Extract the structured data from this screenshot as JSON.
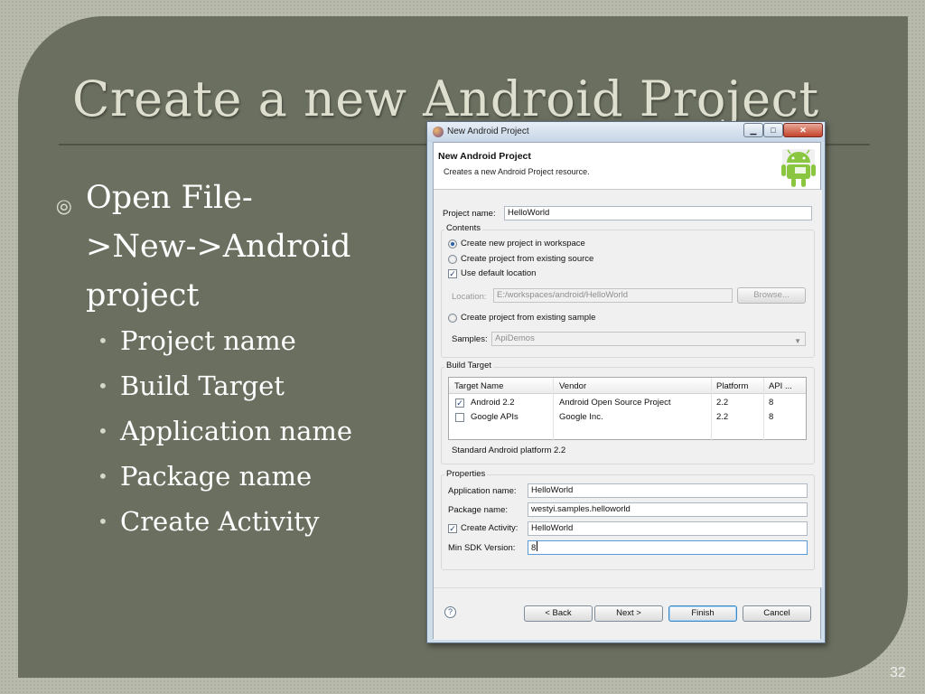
{
  "slide": {
    "title": "Create a new Android Project",
    "main_bullet_marker": "⦾",
    "main_bullet_lines": [
      "Open File-",
      ">New->Android",
      "project"
    ],
    "sub_bullet_marker": "•",
    "sub_bullets": [
      "Project name",
      "Build Target",
      "Application name",
      "Package name",
      "Create Activity"
    ],
    "page_number": "32"
  },
  "dialog": {
    "window_title": "New Android Project",
    "window_buttons": {
      "minimize": "▁",
      "maximize": "□",
      "close": "✕"
    },
    "header_title": "New Android Project",
    "header_subtitle": "Creates a new Android Project resource.",
    "project_name_label": "Project name:",
    "project_name_value": "HelloWorld",
    "contents": {
      "title": "Contents",
      "radio_new": "Create new project in workspace",
      "radio_existing": "Create project from existing source",
      "use_default_location": "Use default location",
      "location_label": "Location:",
      "location_value": "E:/workspaces/android/HelloWorld",
      "browse_label": "Browse...",
      "radio_sample": "Create project from existing sample",
      "samples_label": "Samples:",
      "samples_value": "ApiDemos"
    },
    "build_target": {
      "title": "Build Target",
      "columns": [
        "Target Name",
        "Vendor",
        "Platform",
        "API ..."
      ],
      "rows": [
        {
          "checked": true,
          "name": "Android 2.2",
          "vendor": "Android Open Source Project",
          "platform": "2.2",
          "api": "8"
        },
        {
          "checked": false,
          "name": "Google APIs",
          "vendor": "Google Inc.",
          "platform": "2.2",
          "api": "8"
        }
      ],
      "description": "Standard Android platform 2.2"
    },
    "properties": {
      "title": "Properties",
      "app_name_label": "Application name:",
      "app_name_value": "HelloWorld",
      "package_label": "Package name:",
      "package_value": "westyi.samples.helloworld",
      "create_activity_label": "Create Activity:",
      "create_activity_value": "HelloWorld",
      "min_sdk_label": "Min SDK Version:",
      "min_sdk_value": "8"
    },
    "help_symbol": "?",
    "buttons": {
      "back": "< Back",
      "next": "Next >",
      "finish": "Finish",
      "cancel": "Cancel"
    }
  }
}
